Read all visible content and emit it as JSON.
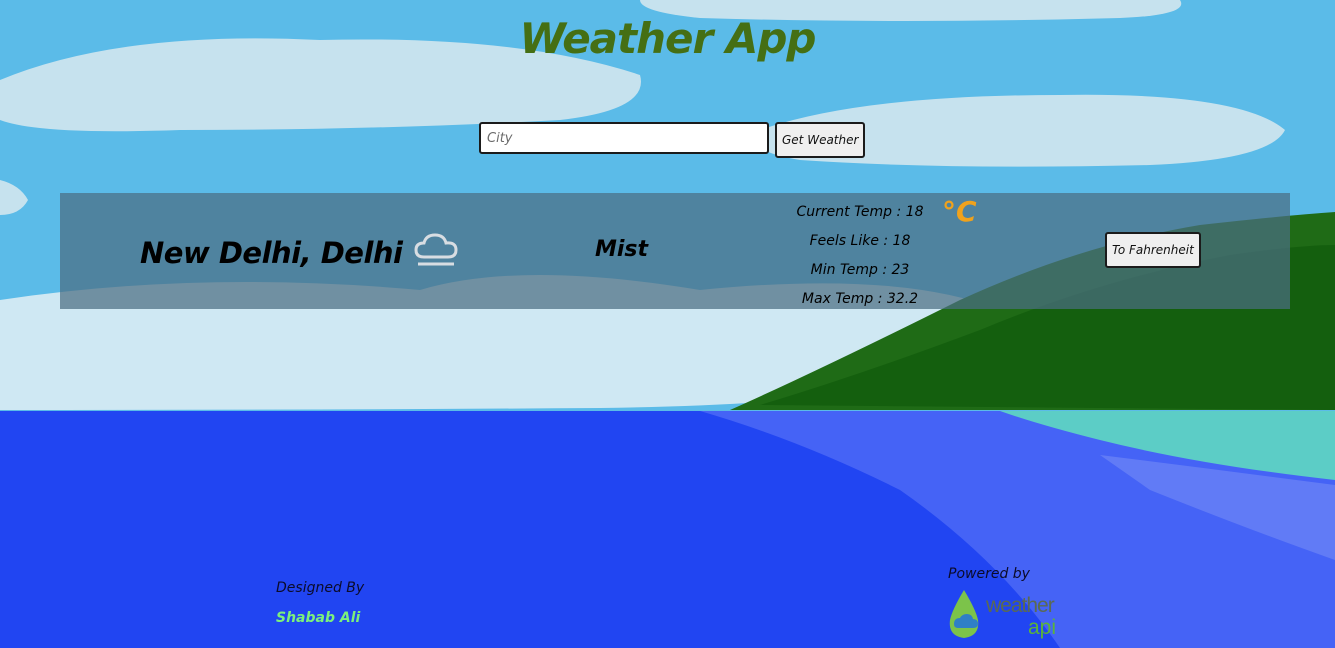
{
  "app": {
    "title": "Weather App"
  },
  "search": {
    "placeholder": "City",
    "button_label": "Get Weather"
  },
  "weather": {
    "location": "New Delhi, Delhi",
    "condition": "Mist",
    "condition_icon": "cloud-icon",
    "current_temp": "Current Temp : 18",
    "feels_like": "Feels Like : 18",
    "min_temp": "Min Temp : 23",
    "max_temp": "Max Temp : 32.2",
    "unit": "°C",
    "toggle_label": "To Fahrenheit"
  },
  "footer": {
    "designed_by": "Designed By",
    "designer": "Shabab Ali",
    "powered_by": "Powered by",
    "logo_word1": "weather",
    "logo_word2": "api"
  },
  "colors": {
    "sky": "#5bbbe8",
    "sea": "#2145f2",
    "title": "#456f14",
    "unit": "#f0a21c",
    "designer": "#7cf07c"
  }
}
